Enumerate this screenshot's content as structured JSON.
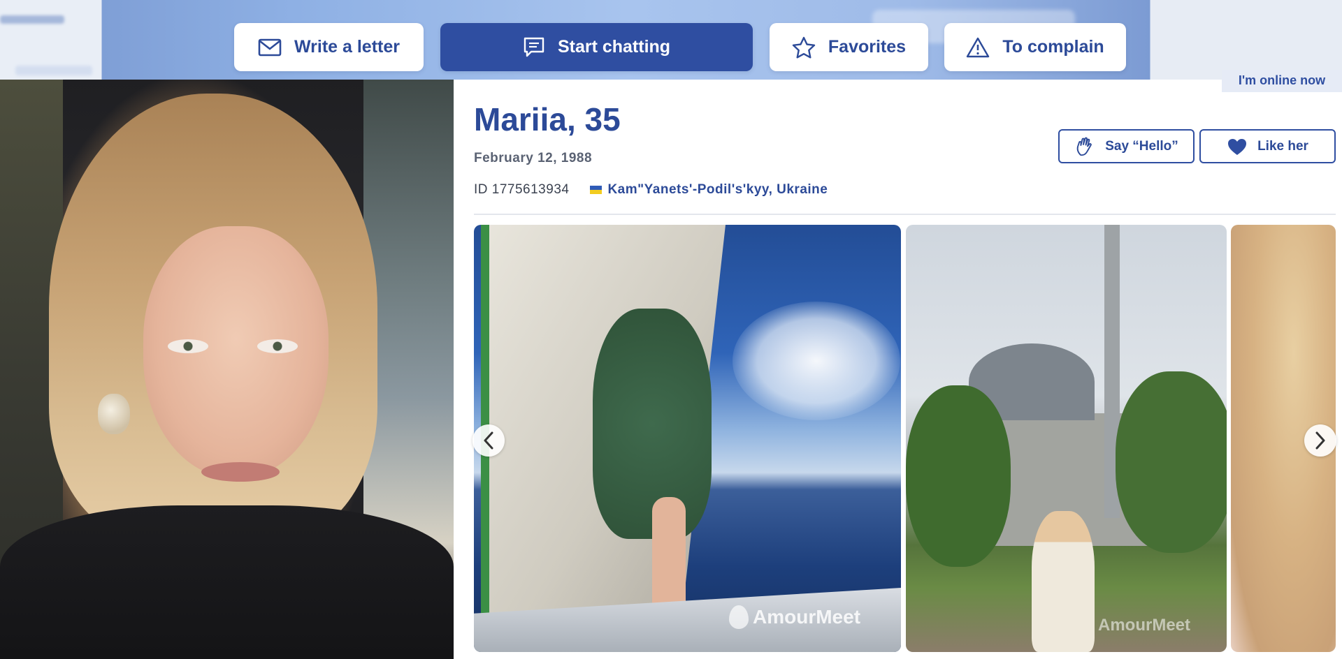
{
  "actions": {
    "write_letter": "Write a letter",
    "start_chatting": "Start chatting",
    "favorites": "Favorites",
    "complain": "To complain"
  },
  "status": {
    "online": "I'm online now"
  },
  "profile": {
    "name_age": "Mariia, 35",
    "birth_date": "February 12, 1988",
    "id": "ID 1775613934",
    "location": "Kam\"Yanets'-Podil's'kyy, Ukraine",
    "flag": "ukraine-flag-icon"
  },
  "quick_actions": {
    "say_hello": "Say “Hello”",
    "like": "Like her"
  },
  "gallery": {
    "watermark": "AmourMeet",
    "photos": [
      "photo-sailboat",
      "photo-mosque",
      "photo-partial"
    ]
  },
  "colors": {
    "brand_blue": "#2f4ea1",
    "brand_text": "#2c4a98",
    "muted_text": "#5a6273"
  },
  "icons": {
    "letter": "envelope-icon",
    "chat": "chat-bubble-icon",
    "favorites": "star-icon",
    "complain": "warning-triangle-icon",
    "hello": "waving-hand-icon",
    "like": "heart-icon",
    "prev": "chevron-left-icon",
    "next": "chevron-right-icon"
  }
}
